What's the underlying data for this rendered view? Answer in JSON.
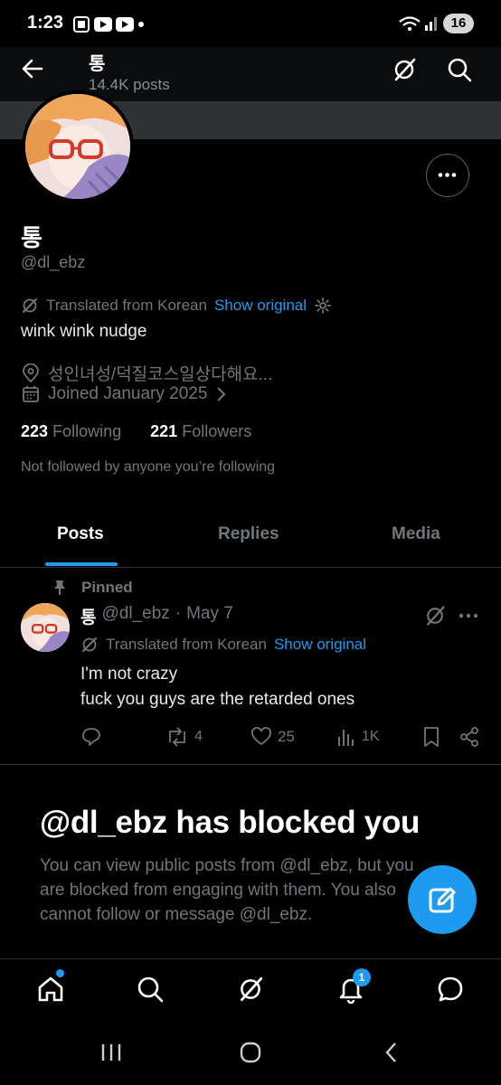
{
  "status_bar": {
    "time": "1:23",
    "battery": "16"
  },
  "header": {
    "name": "통",
    "post_count": "14.4K posts"
  },
  "profile": {
    "name": "통",
    "handle": "@dl_ebz",
    "translated_label": "Translated from Korean",
    "show_original": "Show original",
    "bio": "wink wink nudge",
    "location": "성인녀성/덕질코스일상다해요...",
    "joined": "Joined January 2025",
    "following_count": "223",
    "following_label": "Following",
    "followers_count": "221",
    "followers_label": "Followers",
    "not_followed": "Not followed by anyone you’re following"
  },
  "tabs": [
    {
      "label": "Posts",
      "active": true
    },
    {
      "label": "Replies",
      "active": false
    },
    {
      "label": "Media",
      "active": false
    }
  ],
  "post": {
    "pinned_label": "Pinned",
    "author_name": "통",
    "author_handle": "@dl_ebz",
    "separator": "·",
    "date": "May 7",
    "translated_label": "Translated from Korean",
    "show_original": "Show original",
    "text_line1": "I'm not crazy",
    "text_line2": "fuck you guys are the retarded ones",
    "reposts": "4",
    "likes": "25",
    "views": "1K"
  },
  "blocked": {
    "title": "@dl_ebz has blocked you",
    "description": "You can view public posts from @dl_ebz, but you are blocked from engaging with them. You also cannot follow or message @dl_ebz."
  },
  "bottom_nav": {
    "notifications_badge": "1"
  },
  "colors": {
    "accent": "#1d9bf0",
    "muted": "#71767b",
    "divider": "#2f3336",
    "background": "#000000"
  },
  "icons": [
    "back-arrow-icon",
    "grok-icon",
    "search-icon",
    "more-icon",
    "translate-icon",
    "gear-icon",
    "location-icon",
    "calendar-icon",
    "chevron-right-icon",
    "pin-icon",
    "reply-icon",
    "repost-icon",
    "like-icon",
    "views-icon",
    "bookmark-icon",
    "share-icon",
    "compose-icon",
    "home-icon",
    "bell-icon",
    "messages-icon"
  ]
}
